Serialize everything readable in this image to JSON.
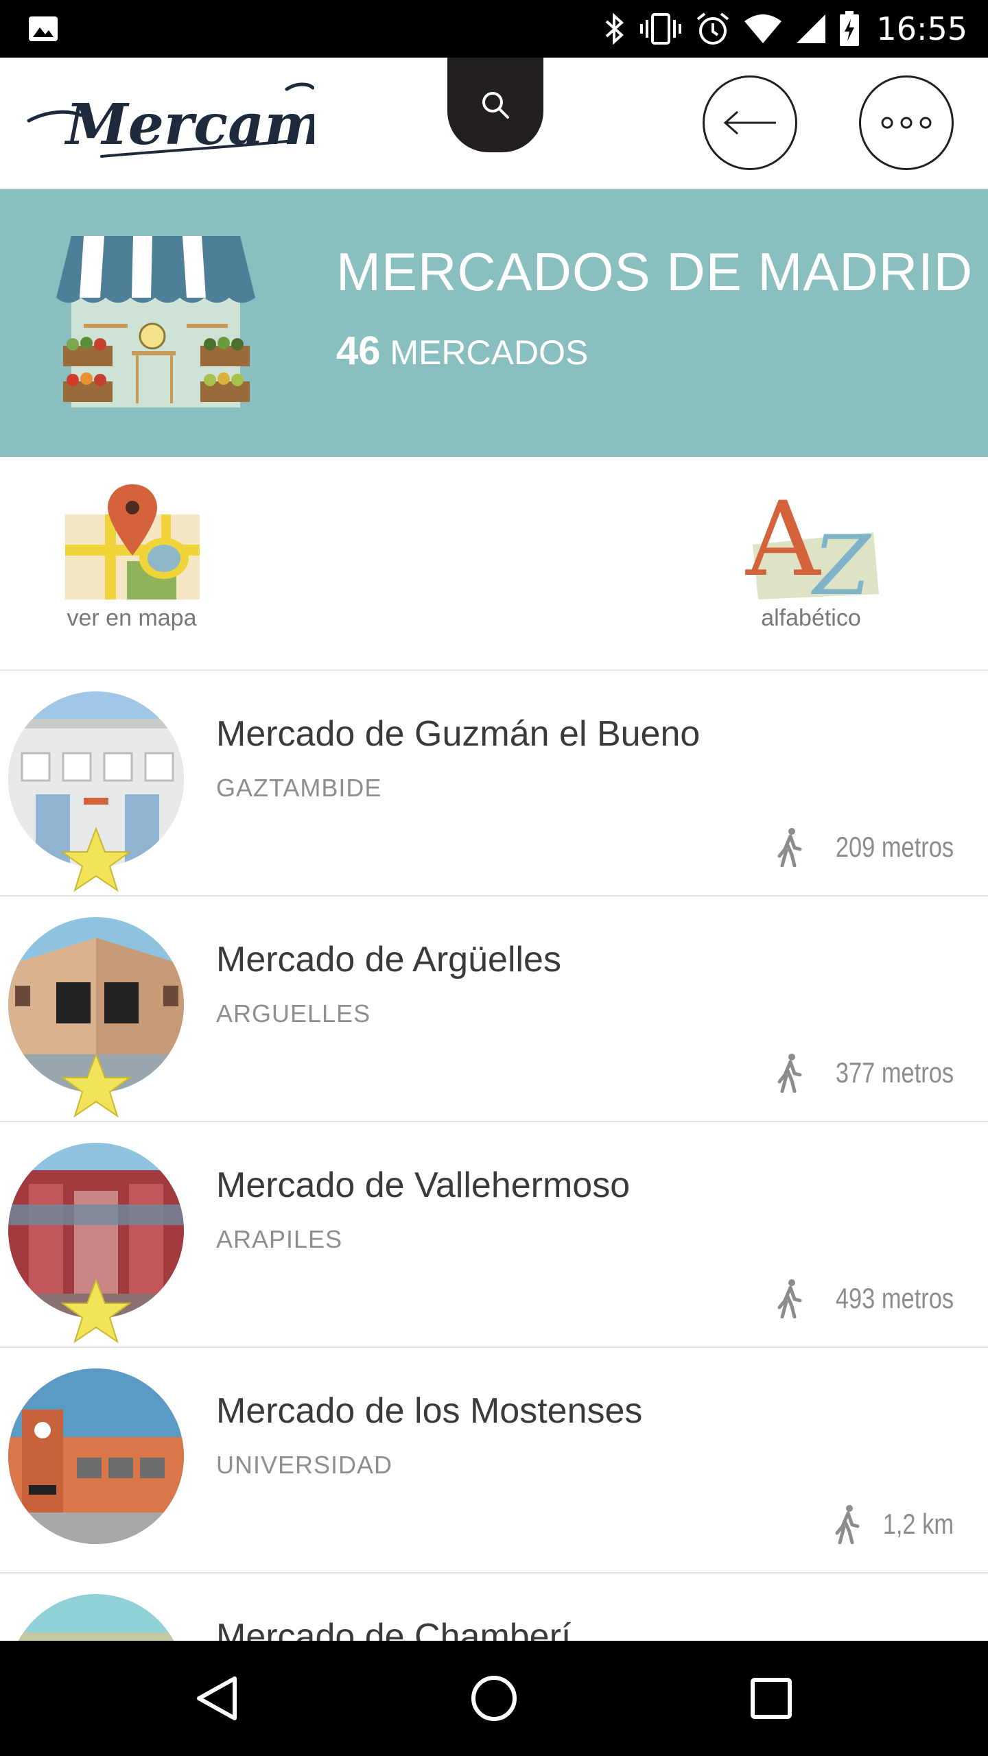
{
  "status_bar": {
    "time": "16:55",
    "icons": [
      "image-icon",
      "bluetooth-icon",
      "vibrate-icon",
      "alarm-icon",
      "wifi-icon",
      "signal-icon",
      "battery-icon"
    ]
  },
  "header": {
    "logo_text": "Mercamad",
    "icons": [
      "search-icon",
      "back-arrow-icon",
      "more-icon"
    ]
  },
  "hero": {
    "title": "MERCADOS DE MADRID",
    "count": "46",
    "count_label": "MERCADOS"
  },
  "options": {
    "map_label": "ver en mapa",
    "alpha_label": "alfabético"
  },
  "markets": [
    {
      "name": "Mercado de Guzmán el Bueno",
      "area": "GAZTAMBIDE",
      "distance": "209 metros",
      "favorite": true,
      "theme": "guzman"
    },
    {
      "name": "Mercado de Argüelles",
      "area": "ARGUELLES",
      "distance": "377 metros",
      "favorite": true,
      "theme": "arguelles"
    },
    {
      "name": "Mercado de Vallehermoso",
      "area": "ARAPILES",
      "distance": "493 metros",
      "favorite": true,
      "theme": "vallehermoso"
    },
    {
      "name": "Mercado de los Mostenses",
      "area": "UNIVERSIDAD",
      "distance": "1,2 km",
      "favorite": false,
      "theme": "mostenses"
    },
    {
      "name": "Mercado de Chamberí",
      "area": "",
      "distance": "",
      "favorite": false,
      "theme": "chamberi"
    }
  ],
  "colors": {
    "hero_bg": "#8abfbf",
    "dark": "#231f20",
    "star": "#f2e35a"
  }
}
